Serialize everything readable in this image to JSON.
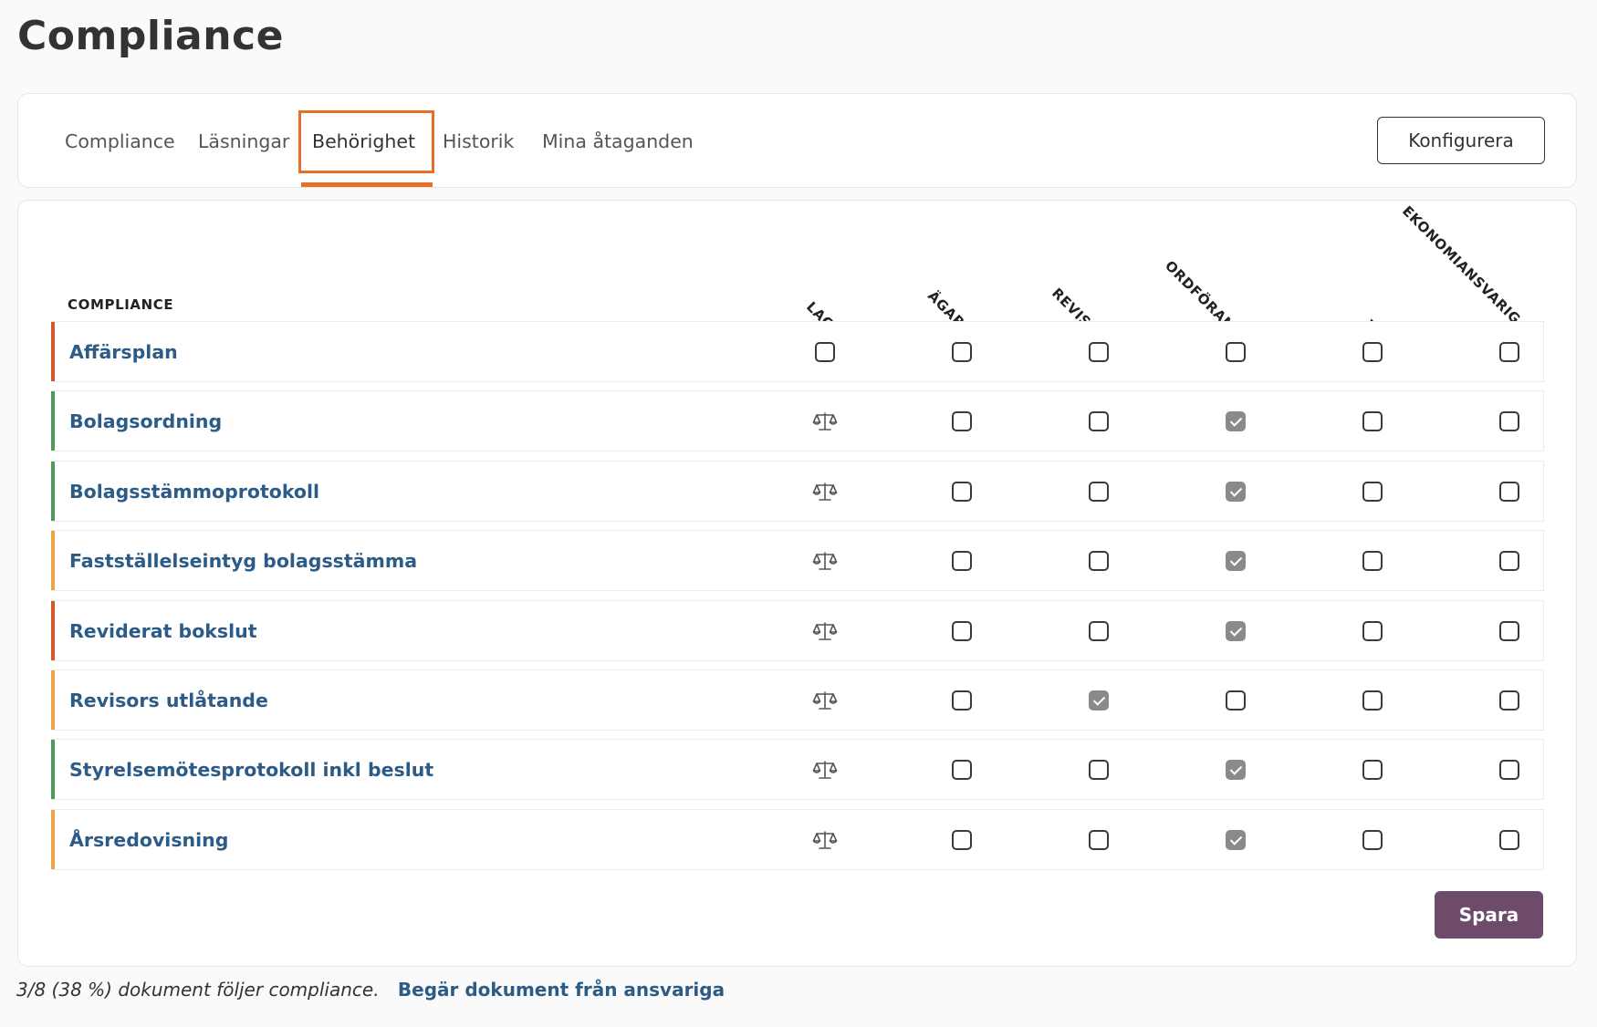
{
  "page": {
    "title": "Compliance"
  },
  "tabs": [
    {
      "label": "Compliance",
      "active": false
    },
    {
      "label": "Läsningar",
      "active": false
    },
    {
      "label": "Behörighet",
      "active": true
    },
    {
      "label": "Historik",
      "active": false
    },
    {
      "label": "Mina åtaganden",
      "active": false
    }
  ],
  "toolbar": {
    "configure_label": "Konfigurera"
  },
  "matrix": {
    "header": "COMPLIANCE",
    "roles": [
      "LAG",
      "ÄGARE",
      "REVISOR",
      "ORDFÖRANDE",
      "VD",
      "EKONOMIANSVARIG"
    ],
    "rows": [
      {
        "name": "Affärsplan",
        "status_color": "#d4572e",
        "law": false,
        "checks": [
          false,
          false,
          false,
          false,
          false,
          false
        ]
      },
      {
        "name": "Bolagsordning",
        "status_color": "#4f9a5a",
        "law": true,
        "checks": [
          null,
          false,
          false,
          true,
          false,
          false
        ]
      },
      {
        "name": "Bolagsstämmoprotokoll",
        "status_color": "#4f9a5a",
        "law": true,
        "checks": [
          null,
          false,
          false,
          true,
          false,
          false
        ]
      },
      {
        "name": "Fastställelseintyg bolagsstämma",
        "status_color": "#f0a24a",
        "law": true,
        "checks": [
          null,
          false,
          false,
          true,
          false,
          false
        ]
      },
      {
        "name": "Reviderat bokslut",
        "status_color": "#d4572e",
        "law": true,
        "checks": [
          null,
          false,
          false,
          true,
          false,
          false
        ]
      },
      {
        "name": "Revisors utlåtande",
        "status_color": "#f0a24a",
        "law": true,
        "checks": [
          null,
          false,
          true,
          false,
          false,
          false
        ]
      },
      {
        "name": "Styrelsemötesprotokoll inkl beslut",
        "status_color": "#4f9a5a",
        "law": true,
        "checks": [
          null,
          false,
          false,
          true,
          false,
          false
        ]
      },
      {
        "name": "Årsredovisning",
        "status_color": "#f0a24a",
        "law": true,
        "checks": [
          null,
          false,
          false,
          true,
          false,
          false
        ]
      }
    ],
    "save_label": "Spara",
    "law_icon": "scale-icon"
  },
  "footer": {
    "status_text": "3/8 (38 %) dokument följer compliance.",
    "request_link": "Begär dokument från ansvariga"
  }
}
